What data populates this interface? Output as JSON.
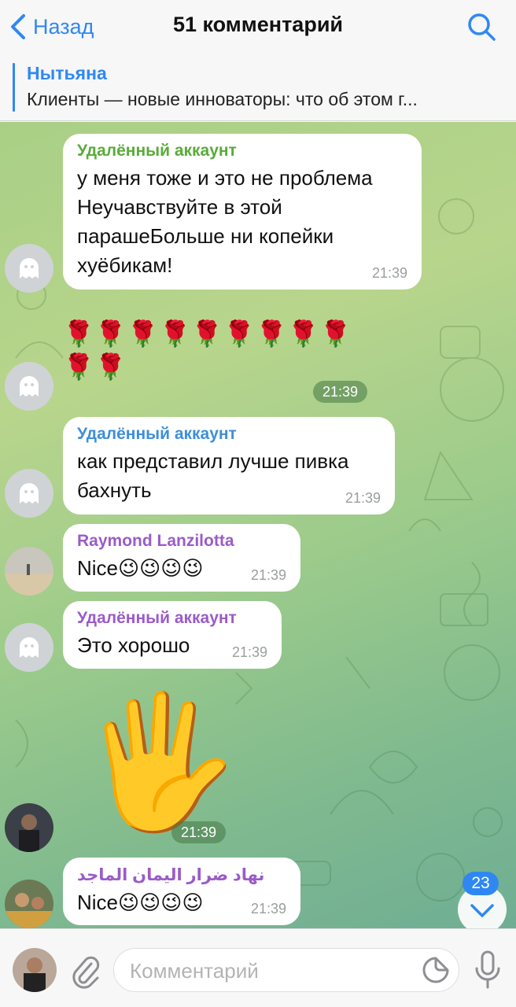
{
  "header": {
    "back_label": "Назад",
    "title": "51 комментарий",
    "back_icon": "chevron-left-icon",
    "search_icon": "search-icon"
  },
  "pinned": {
    "name": "Нытьяна",
    "text": "Клиенты — новые инноваторы: что об этом г..."
  },
  "messages": [
    {
      "sender": "Удалённый аккаунт",
      "sender_color": "#5aab3a",
      "lines": [
        "у меня тоже и это не проблема",
        "Неучавствуйте в этой",
        "парашеБольше ни копейки",
        "хуёбикам!"
      ],
      "time": "21:39"
    },
    {
      "content": "🌹🌹🌹🌹🌹🌹🌹🌹🌹🌹🌹",
      "time": "21:39"
    },
    {
      "sender": "Удалённый аккаунт",
      "sender_color": "#3d8fd8",
      "lines": [
        "как представил лучше пивка",
        "бахнуть"
      ],
      "time": "21:39"
    },
    {
      "sender": "Raymond Lanzilotta",
      "sender_color": "#9a5cc8",
      "lines": [
        "Nice😉😉😉😉"
      ],
      "time": "21:39"
    },
    {
      "sender": "Удалённый аккаунт",
      "sender_color": "#9a5cc8",
      "lines": [
        "Это хорошо"
      ],
      "time": "21:39"
    },
    {
      "content": "🖐️",
      "time": "21:39"
    },
    {
      "sender": "نهاد ضرار اليمان الماجد",
      "sender_color": "#9a5cc8",
      "lines": [
        "Nice😉😉😉😉"
      ],
      "time": "21:39"
    }
  ],
  "unread_count": "23",
  "composer": {
    "placeholder": "Комментарий",
    "attach_icon": "paperclip-icon",
    "sticker_icon": "sticker-icon",
    "mic_icon": "microphone-icon"
  },
  "colors": {
    "accent": "#2f88f2",
    "bubble": "#ffffff"
  }
}
